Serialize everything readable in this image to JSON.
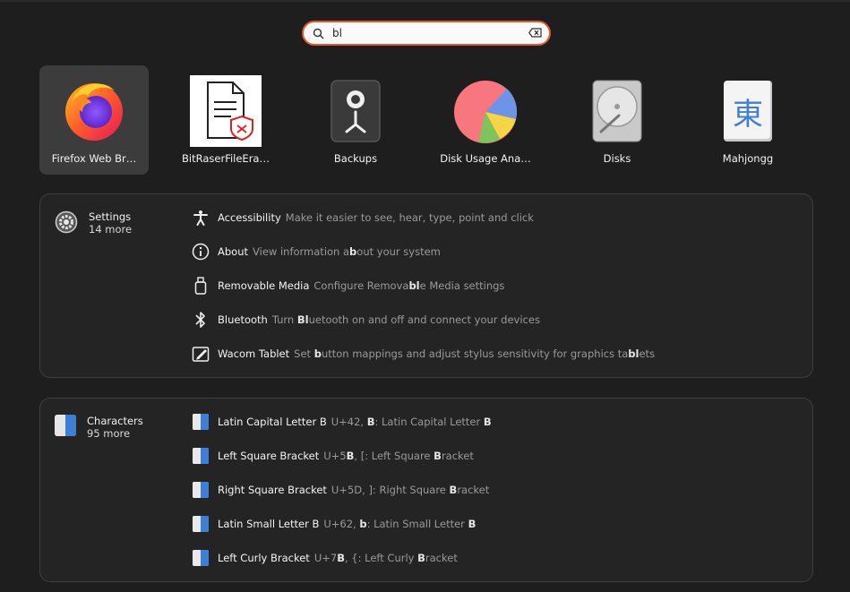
{
  "search": {
    "value": "bl",
    "placeholder": ""
  },
  "apps": [
    {
      "name": "Firefox Web Br…",
      "icon": "firefox-icon",
      "selected": true
    },
    {
      "name": "BitRaserFileEra…",
      "icon": "bitraser-icon",
      "selected": false
    },
    {
      "name": "Backups",
      "icon": "backups-icon",
      "selected": false
    },
    {
      "name": "Disk Usage Ana…",
      "icon": "disk-usage-icon",
      "selected": false
    },
    {
      "name": "Disks",
      "icon": "disks-icon",
      "selected": false
    },
    {
      "name": "Mahjongg",
      "icon": "mahjongg-icon",
      "selected": false
    }
  ],
  "mahjongg_glyph": "東",
  "settings": {
    "name": "Settings",
    "more": "14 more",
    "items": [
      {
        "title": "Accessibility",
        "desc_html": "Make it easier to see, hear, type, point and click",
        "icon": "accessibility-icon"
      },
      {
        "title": "About",
        "desc_html": "View information a<b>b</b>out your system",
        "icon": "info-icon"
      },
      {
        "title": "Removable Media",
        "desc_html": "Configure Remova<b>bl</b>e Media settings",
        "icon": "usb-icon"
      },
      {
        "title": "Bluetooth",
        "desc_html": "Turn <b>Bl</b>uetooth on and off and connect your devices",
        "icon": "bluetooth-icon"
      },
      {
        "title": "Wacom Tablet",
        "desc_html": "Set <b>b</b>utton mappings and adjust stylus sensitivity for graphics ta<b>bl</b>ets",
        "icon": "tablet-icon"
      }
    ]
  },
  "characters": {
    "name": "Characters",
    "more": "95 more",
    "items": [
      {
        "title": "Latin Capital Letter B",
        "desc_html": "U+42, <b>B</b>: Latin Capital Letter <b>B</b>"
      },
      {
        "title": "Left Square Bracket",
        "desc_html": "U+5<b>B</b>, [: Left Square <b>B</b>racket"
      },
      {
        "title": "Right Square Bracket",
        "desc_html": "U+5D, ]: Right Square <b>B</b>racket"
      },
      {
        "title": "Latin Small Letter B",
        "desc_html": "U+62, <b>b</b>: Latin Small Letter <b>B</b>"
      },
      {
        "title": "Left Curly Bracket",
        "desc_html": "U+7<b>B</b>, {: Left Curly <b>B</b>racket"
      }
    ]
  },
  "colors": {
    "accent": "#e95420",
    "background": "#1e1e1e",
    "panel": "#242424"
  }
}
